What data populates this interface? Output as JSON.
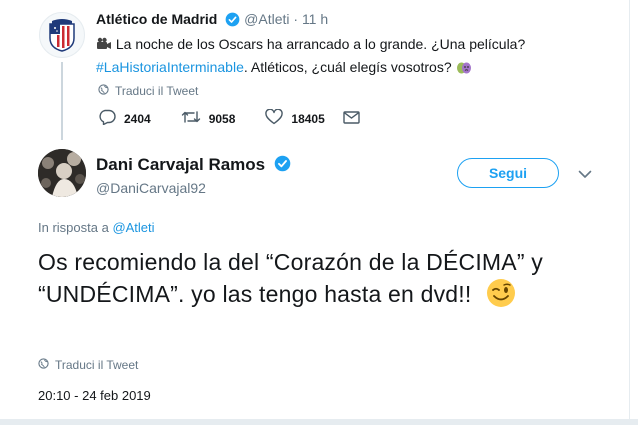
{
  "parent_tweet": {
    "name": "Atlético de Madrid",
    "handle": "@Atleti",
    "separator": "·",
    "time": "11 h",
    "text_part1": " La noche de los Oscars ha arrancado a lo grande. ¿Una película?",
    "hashtag": "#LaHistoriaInterminable",
    "text_part2": ". Atléticos, ¿cuál elegís vosotros?",
    "film_emoji": "film-camera-icon",
    "masks_emoji": "performing-arts-icon",
    "translate": "Traduci il Tweet",
    "actions": {
      "replies": "2404",
      "retweets": "9058",
      "likes": "18405"
    }
  },
  "tweet": {
    "name": "Dani Carvajal Ramos",
    "handle": "@DaniCarvajal92",
    "follow_label": "Segui",
    "reply_prefix": "In risposta a ",
    "reply_handle": "@Atleti",
    "text_line": "Os recomiendo la del “Corazón de la DÉCIMA” y “UNDÉCIMA”. yo las tengo hasta en dvd!!",
    "emoji": "winking-face-icon",
    "translate": "Traduci il Tweet",
    "timestamp": "20:10 - 24 feb 2019"
  },
  "colors": {
    "accent": "#1da1f2",
    "link": "#1b95e0",
    "muted": "#657786",
    "text": "#14171a"
  }
}
